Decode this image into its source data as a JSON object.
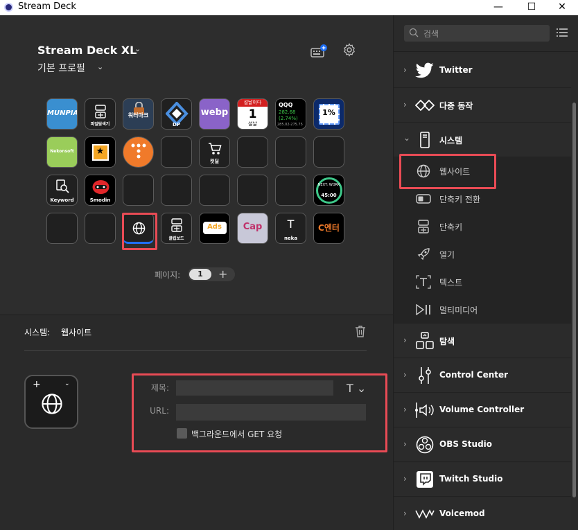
{
  "window": {
    "title": "Stream Deck",
    "minimize": "—",
    "maximize": "☐",
    "close": "✕"
  },
  "deck": {
    "name": "Stream Deck XL",
    "profile": "기본 프로필"
  },
  "keys": [
    [
      "MUNPIA",
      "",
      "워터마크",
      "DP",
      "webp",
      "설날",
      "QQQ",
      "1%"
    ],
    [
      "Nekonsoft",
      "",
      "",
      "",
      "컷딜",
      "",
      "",
      ""
    ],
    [
      "Keyword",
      "Smodin",
      "",
      "",
      "",
      "",
      "",
      "NEXT: WORK 45:00"
    ],
    [
      "",
      "",
      "",
      "클립보드",
      "Ads",
      "Cap",
      "neka",
      "C엔터"
    ]
  ],
  "key_extra": {
    "calc1": "파일탐색기",
    "cal_head": "설날이다",
    "cal_day": "1",
    "stock_up": "282.68",
    "stock_pct": "(2.74%)",
    "stock_date": "285.02-275.75",
    "percent": "1%",
    "next_work": "NEXT: WORK",
    "timer": "45:00"
  },
  "pager": {
    "label": "페이지:",
    "current": "1",
    "add": "+"
  },
  "properties": {
    "category": "시스템:",
    "action": "웹사이트",
    "title_label": "제목:",
    "title_value": "",
    "url_label": "URL:",
    "url_value": "",
    "checkbox_label": "백그라운드에서 GET 요청",
    "checkbox_checked": false
  },
  "sidebar": {
    "search_placeholder": "검색",
    "categories_top": [
      {
        "name": "Twitter",
        "icon": "twitter-icon"
      },
      {
        "name": "다중 동작",
        "icon": "multi-action-icon"
      },
      {
        "name": "시스템",
        "icon": "system-icon",
        "expanded": true
      }
    ],
    "system_actions": [
      {
        "name": "웹사이트",
        "icon": "globe-icon"
      },
      {
        "name": "단축키 전환",
        "icon": "hotkey-switch-icon"
      },
      {
        "name": "단축키",
        "icon": "hotkey-icon"
      },
      {
        "name": "열기",
        "icon": "rocket-icon"
      },
      {
        "name": "텍스트",
        "icon": "text-icon"
      },
      {
        "name": "멀티미디어",
        "icon": "multimedia-icon"
      }
    ],
    "categories_bottom": [
      {
        "name": "탐색",
        "icon": "navigation-icon"
      },
      {
        "name": "Control Center",
        "icon": "control-center-icon"
      },
      {
        "name": "Volume Controller",
        "icon": "volume-controller-icon"
      },
      {
        "name": "OBS Studio",
        "icon": "obs-icon"
      },
      {
        "name": "Twitch Studio",
        "icon": "twitch-icon"
      },
      {
        "name": "Voicemod",
        "icon": "voicemod-icon"
      }
    ]
  },
  "colors": {
    "highlight": "#e94b55",
    "accent_blue": "#1e6ff5"
  }
}
